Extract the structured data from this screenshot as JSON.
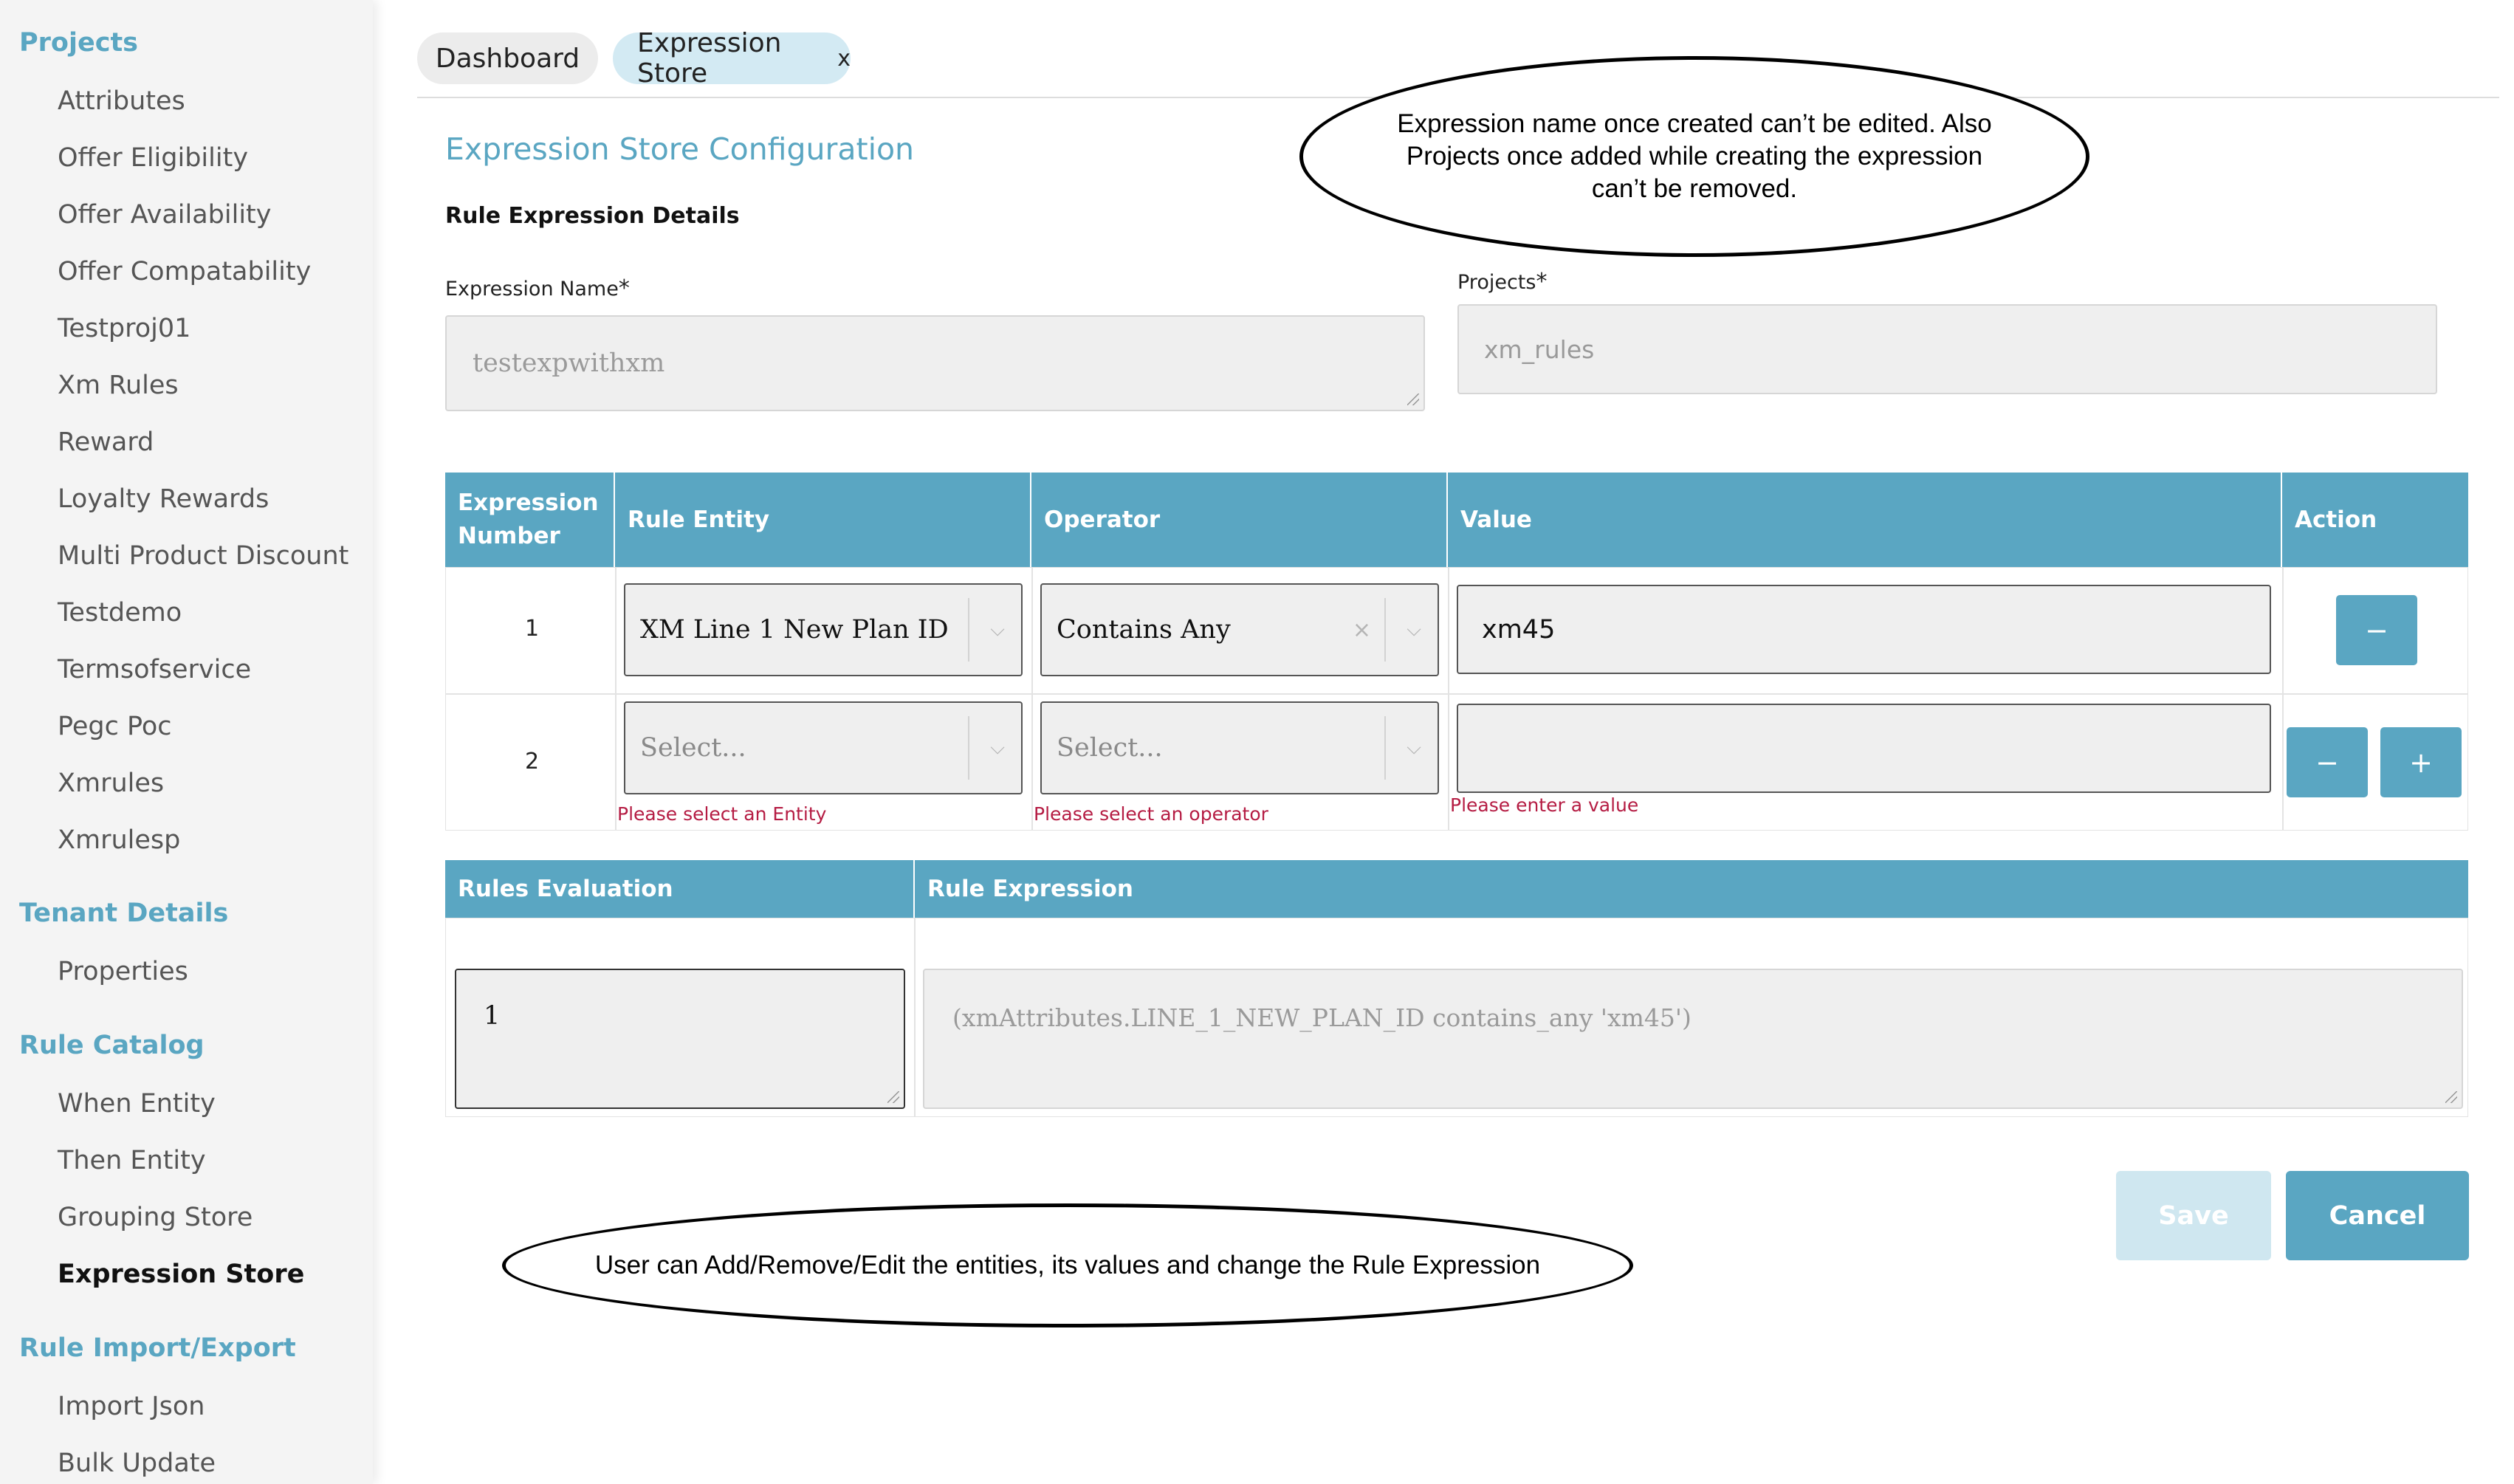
{
  "sidebar": {
    "sections": [
      {
        "title": "Projects",
        "items": [
          "Attributes",
          "Offer Eligibility",
          "Offer Availability",
          "Offer Compatability",
          "Testproj01",
          "Xm Rules",
          "Reward",
          "Loyalty Rewards",
          "Multi Product Discount",
          "Testdemo",
          "Termsofservice",
          "Pegc Poc",
          "Xmrules",
          "Xmrulesp"
        ]
      },
      {
        "title": "Tenant Details",
        "items": [
          "Properties"
        ]
      },
      {
        "title": "Rule Catalog",
        "items": [
          "When Entity",
          "Then Entity",
          "Grouping Store",
          "Expression Store"
        ]
      },
      {
        "title": "Rule Import/Export",
        "items": [
          "Import Json",
          "Bulk Update"
        ]
      }
    ],
    "active_item": "Expression Store"
  },
  "tabs": [
    {
      "label": "Dashboard"
    },
    {
      "label": "Expression Store",
      "close": "x"
    }
  ],
  "page": {
    "title": "Expression Store Configuration",
    "subtitle": "Rule Expression Details",
    "expression_name_label": "Expression Name",
    "expression_name_value": "testexpwithxm",
    "projects_label": "Projects",
    "projects_value": "xm_rules",
    "required_mark": "*"
  },
  "expr_table": {
    "headers": [
      "Expression Number",
      "Rule Entity",
      "Operator",
      "Value",
      "Action"
    ],
    "rows": [
      {
        "number": "1",
        "entity": "XM Line 1 New Plan ID",
        "operator": "Contains Any",
        "value": "xm45"
      },
      {
        "number": "2",
        "entity": "Select...",
        "operator": "Select...",
        "value": "",
        "entity_error": "Please select an Entity",
        "operator_error": "Please select an operator",
        "value_error": "Please enter a value"
      }
    ],
    "remove_icon": "−",
    "add_icon": "+"
  },
  "eval_table": {
    "headers": [
      "Rules Evaluation",
      "Rule Expression"
    ],
    "evaluation_value": "1",
    "expression_value": "(xmAttributes.LINE_1_NEW_PLAN_ID contains_any 'xm45')"
  },
  "buttons": {
    "save": "Save",
    "cancel": "Cancel"
  },
  "annotations": {
    "top": "Expression name once created can’t be edited. Also Projects once added while creating the expression can’t be removed.",
    "bottom": "User can Add/Remove/Edit  the entities, its values  and change the Rule Expression"
  },
  "colors": {
    "accent": "#5aa6c2",
    "error": "#b51c43",
    "tab_active": "#d3eaf3"
  }
}
